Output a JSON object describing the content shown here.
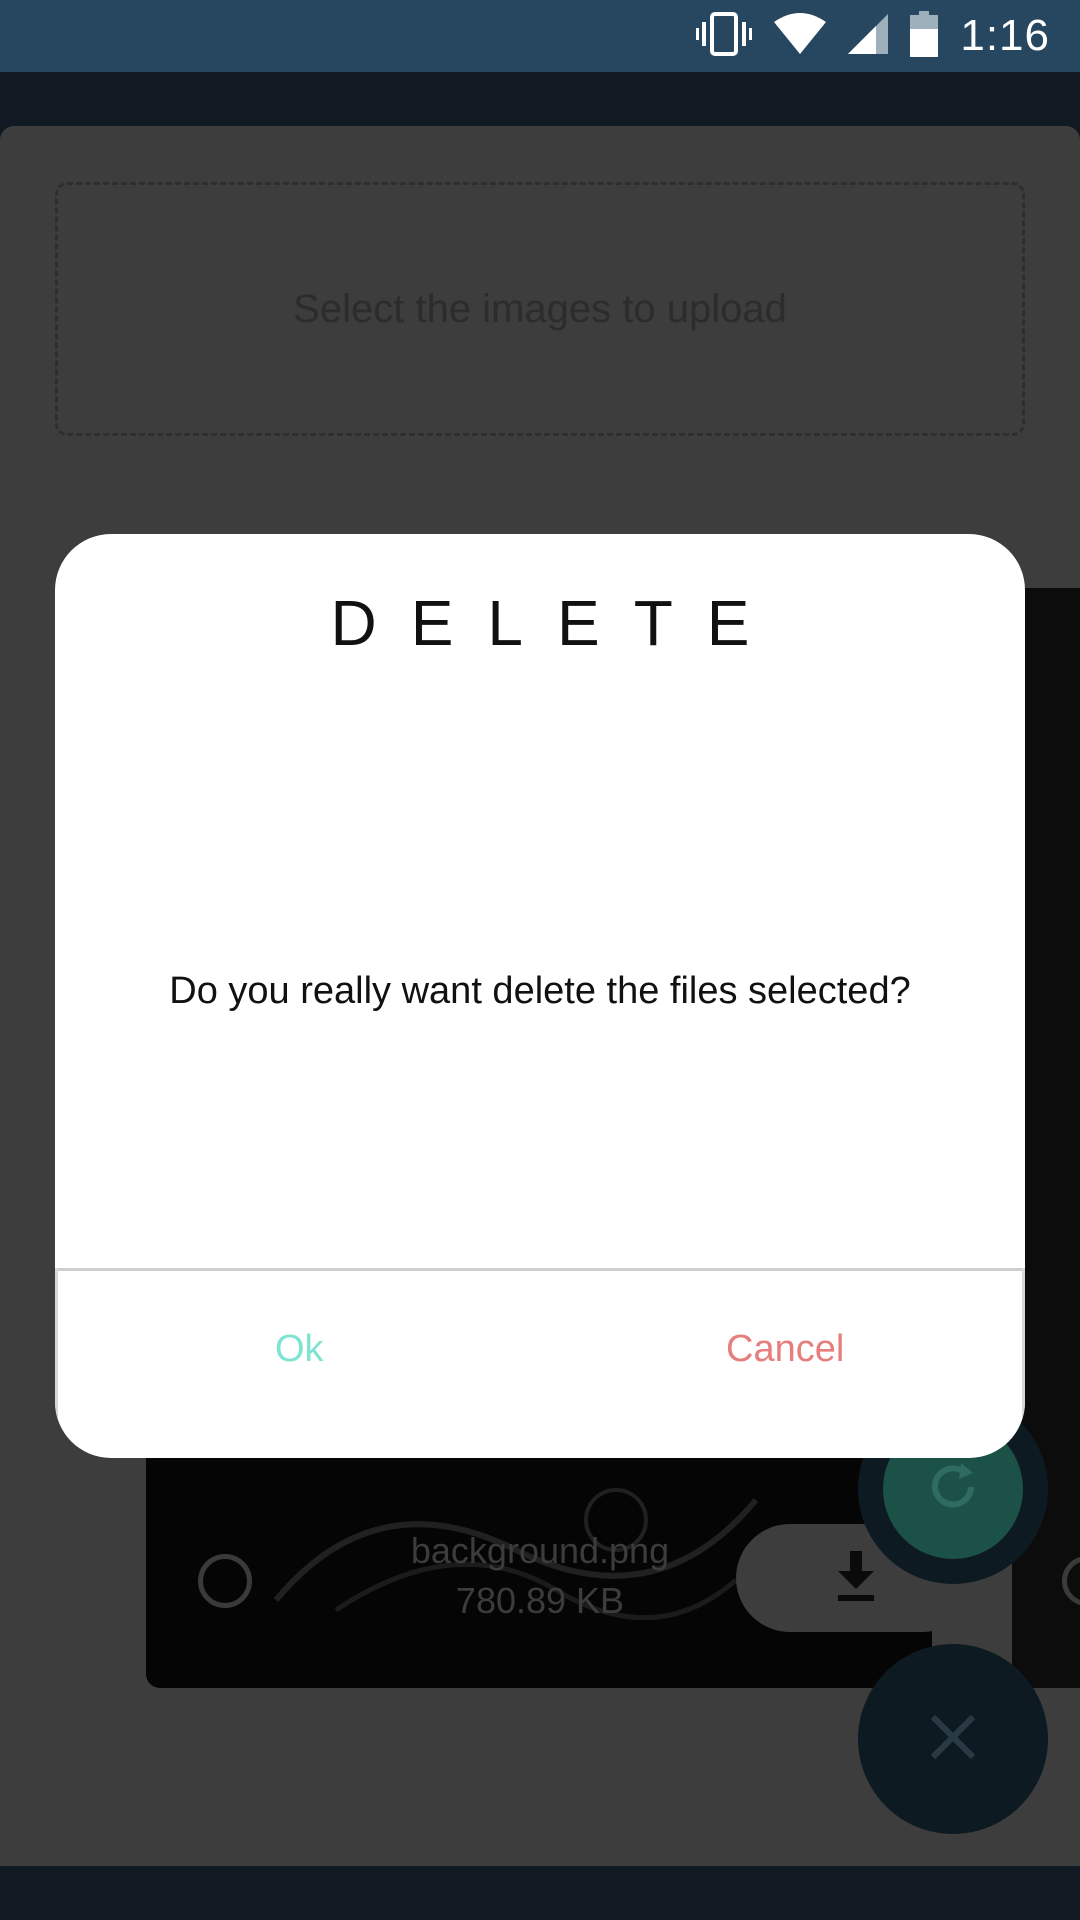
{
  "status_bar": {
    "time": "1:16",
    "icons": [
      "vibrate-icon",
      "wifi-icon",
      "signal-icon",
      "battery-icon"
    ]
  },
  "upload": {
    "prompt": "Select the images to upload"
  },
  "file_card": {
    "name": "background.png",
    "size": "780.89 KB"
  },
  "dialog": {
    "title": "DELETE",
    "message": "Do you really want delete the files selected?",
    "ok_label": "Ok",
    "cancel_label": "Cancel"
  },
  "colors": {
    "status_bar": "#27465f",
    "ok": "#7fe3d2",
    "cancel": "#e57e7c"
  }
}
